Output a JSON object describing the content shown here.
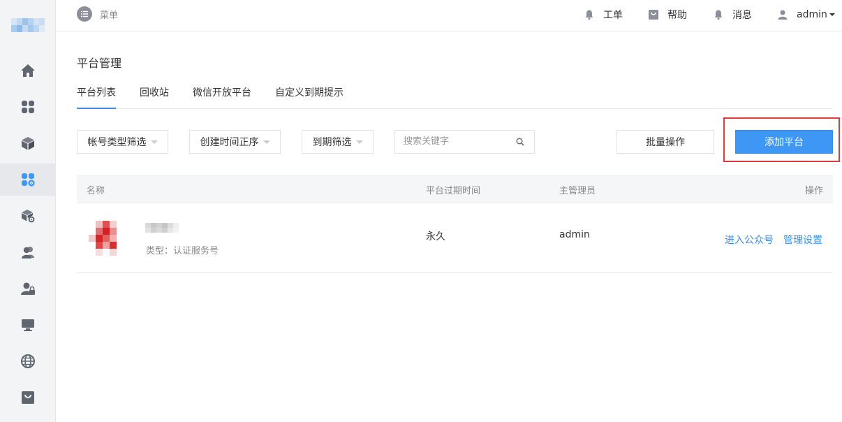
{
  "topbar": {
    "menu_label": "菜单",
    "items": [
      {
        "label": "工单",
        "icon": "bell-icon"
      },
      {
        "label": "帮助",
        "icon": "bag-icon"
      },
      {
        "label": "消息",
        "icon": "bell-icon"
      }
    ],
    "user": "admin"
  },
  "sidebar": {
    "items": [
      {
        "icon": "home-icon"
      },
      {
        "icon": "grid-icon"
      },
      {
        "icon": "cube-icon"
      },
      {
        "icon": "grid-settings-icon",
        "active": true
      },
      {
        "icon": "cube-settings-icon"
      },
      {
        "icon": "users-icon"
      },
      {
        "icon": "user-lock-icon"
      },
      {
        "icon": "monitor-icon"
      },
      {
        "icon": "globe-icon"
      },
      {
        "icon": "bag-icon"
      }
    ]
  },
  "page": {
    "title": "平台管理",
    "tabs": [
      "平台列表",
      "回收站",
      "微信开放平台",
      "自定义到期提示"
    ],
    "active_tab": "平台列表"
  },
  "toolbar": {
    "filter_account_type": "帐号类型筛选",
    "filter_created_order": "创建时间正序",
    "filter_expiry": "到期筛选",
    "search_placeholder": "搜索关键字",
    "batch_label": "批量操作",
    "add_label": "添加平台"
  },
  "table": {
    "headers": [
      "名称",
      "平台过期时间",
      "主管理员",
      "操作"
    ],
    "rows": [
      {
        "type_text": "类型：认证服务号",
        "expiry": "永久",
        "admin": "admin",
        "actions": [
          "进入公众号",
          "管理设置"
        ]
      }
    ]
  },
  "colors": {
    "accent": "#3e96f5",
    "link": "#3a8ee6",
    "highlight_border": "#e0393e"
  }
}
